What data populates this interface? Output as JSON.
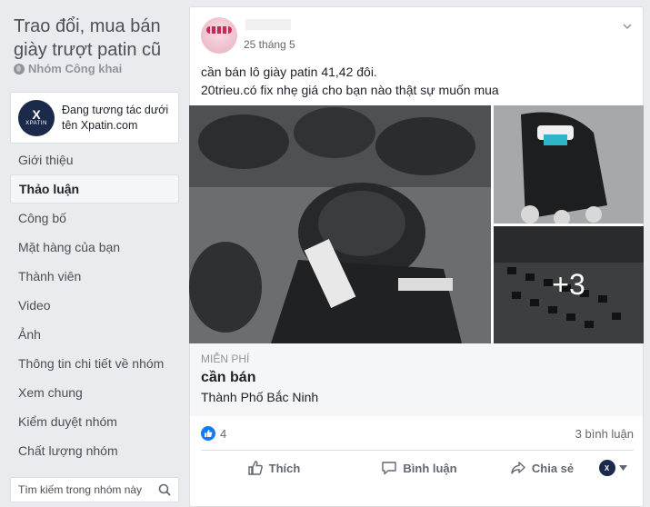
{
  "group": {
    "title": "Trao đổi, mua bán giày trượt patin cũ",
    "privacy": "Nhóm Công khai"
  },
  "interact_card": {
    "logo_text": "X",
    "logo_word": "XPATIN",
    "text": "Đang tương tác dưới tên Xpatin.com"
  },
  "nav": {
    "items": [
      {
        "label": "Giới thiệu"
      },
      {
        "label": "Thảo luận"
      },
      {
        "label": "Công bố"
      },
      {
        "label": "Mặt hàng của bạn"
      },
      {
        "label": "Thành viên"
      },
      {
        "label": "Video"
      },
      {
        "label": "Ảnh"
      },
      {
        "label": "Thông tin chi tiết về nhóm"
      },
      {
        "label": "Xem chung"
      },
      {
        "label": "Kiểm duyệt nhóm"
      },
      {
        "label": "Chất lượng nhóm"
      }
    ],
    "active_index": 1
  },
  "search": {
    "placeholder": "Tìm kiếm trong nhóm này"
  },
  "post": {
    "time": "25 tháng 5",
    "text_line1": "cần bán lô giày patin 41,42 đôi.",
    "text_line2": "20trieu.có fix nhẹ giá cho bạn nào thật sự muốn mua",
    "more_photos": "+3",
    "listing": {
      "price": "MIỄN PHÍ",
      "title": "cần bán",
      "location": "Thành Phố Bắc Ninh"
    },
    "reactions_count": "4",
    "comments_count": "3 bình luận",
    "actions": {
      "like": "Thích",
      "comment": "Bình luận",
      "share": "Chia sẻ"
    }
  },
  "colors": {
    "accent": "#1877f2",
    "page_bg": "#e9ebee",
    "logo_bg": "#1b2a4a"
  }
}
